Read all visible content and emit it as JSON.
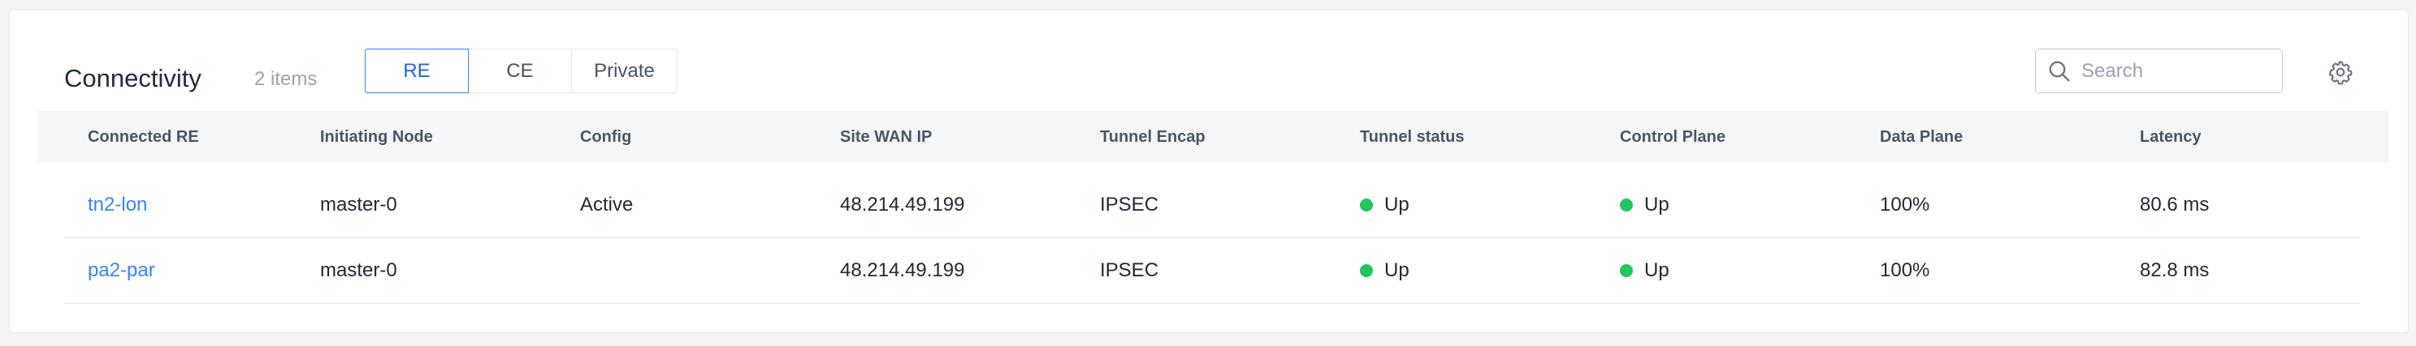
{
  "header": {
    "title": "Connectivity",
    "count": "2 items",
    "tabs": [
      {
        "label": "RE",
        "active": true
      },
      {
        "label": "CE",
        "active": false
      },
      {
        "label": "Private",
        "active": false
      }
    ],
    "search": {
      "placeholder": "Search",
      "value": "",
      "icon": "search-icon"
    },
    "settings_icon": "gear-icon"
  },
  "table": {
    "columns": [
      "Connected RE",
      "Initiating Node",
      "Config",
      "Site WAN IP",
      "Tunnel Encap",
      "Tunnel status",
      "Control Plane",
      "Data Plane",
      "Latency"
    ],
    "rows": [
      {
        "connected_re": "tn2-lon",
        "initiating_node": "master-0",
        "config": "Active",
        "site_wan_ip": "48.214.49.199",
        "tunnel_encap": "IPSEC",
        "tunnel_status": "Up",
        "control_plane": "Up",
        "data_plane": "100%",
        "latency": "80.6 ms"
      },
      {
        "connected_re": "pa2-par",
        "initiating_node": "master-0",
        "config": "",
        "site_wan_ip": "48.214.49.199",
        "tunnel_encap": "IPSEC",
        "tunnel_status": "Up",
        "control_plane": "Up",
        "data_plane": "100%",
        "latency": "82.8 ms"
      }
    ]
  },
  "colors": {
    "accent": "#3b82f6",
    "status_up": "#22c55e"
  }
}
